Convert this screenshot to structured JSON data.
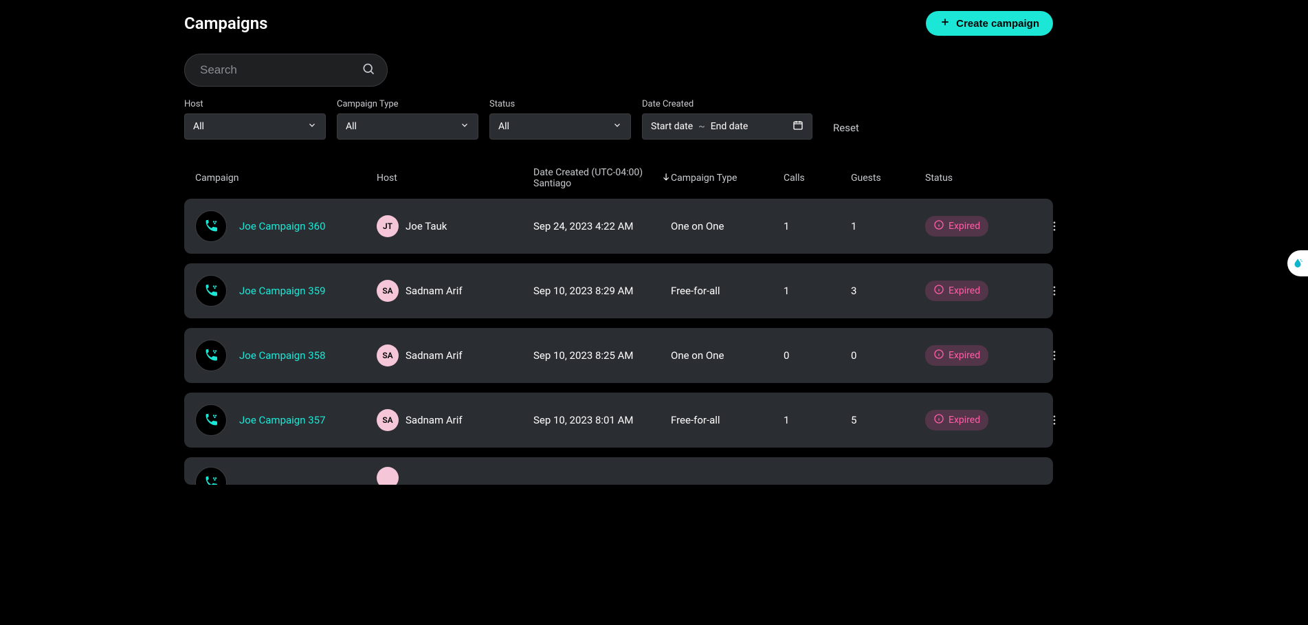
{
  "header": {
    "title": "Campaigns",
    "create_label": "Create campaign"
  },
  "search": {
    "placeholder": "Search"
  },
  "filters": {
    "host": {
      "label": "Host",
      "value": "All"
    },
    "type": {
      "label": "Campaign Type",
      "value": "All"
    },
    "status": {
      "label": "Status",
      "value": "All"
    },
    "date": {
      "label": "Date Created",
      "start": "Start date",
      "end": "End date",
      "sep": "~"
    },
    "reset": "Reset"
  },
  "table": {
    "headers": {
      "campaign": "Campaign",
      "host": "Host",
      "date": "Date Created (UTC-04:00) Santiago",
      "type": "Campaign Type",
      "calls": "Calls",
      "guests": "Guests",
      "status": "Status"
    },
    "rows": [
      {
        "name": "Joe Campaign 360",
        "host_initials": "JT",
        "host": "Joe Tauk",
        "date": "Sep 24, 2023 4:22 AM",
        "type": "One on One",
        "calls": "1",
        "guests": "1",
        "status": "Expired"
      },
      {
        "name": "Joe Campaign 359",
        "host_initials": "SA",
        "host": "Sadnam Arif",
        "date": "Sep 10, 2023 8:29 AM",
        "type": "Free-for-all",
        "calls": "1",
        "guests": "3",
        "status": "Expired"
      },
      {
        "name": "Joe Campaign 358",
        "host_initials": "SA",
        "host": "Sadnam Arif",
        "date": "Sep 10, 2023 8:25 AM",
        "type": "One on One",
        "calls": "0",
        "guests": "0",
        "status": "Expired"
      },
      {
        "name": "Joe Campaign 357",
        "host_initials": "SA",
        "host": "Sadnam Arif",
        "date": "Sep 10, 2023 8:01 AM",
        "type": "Free-for-all",
        "calls": "1",
        "guests": "5",
        "status": "Expired"
      }
    ]
  }
}
